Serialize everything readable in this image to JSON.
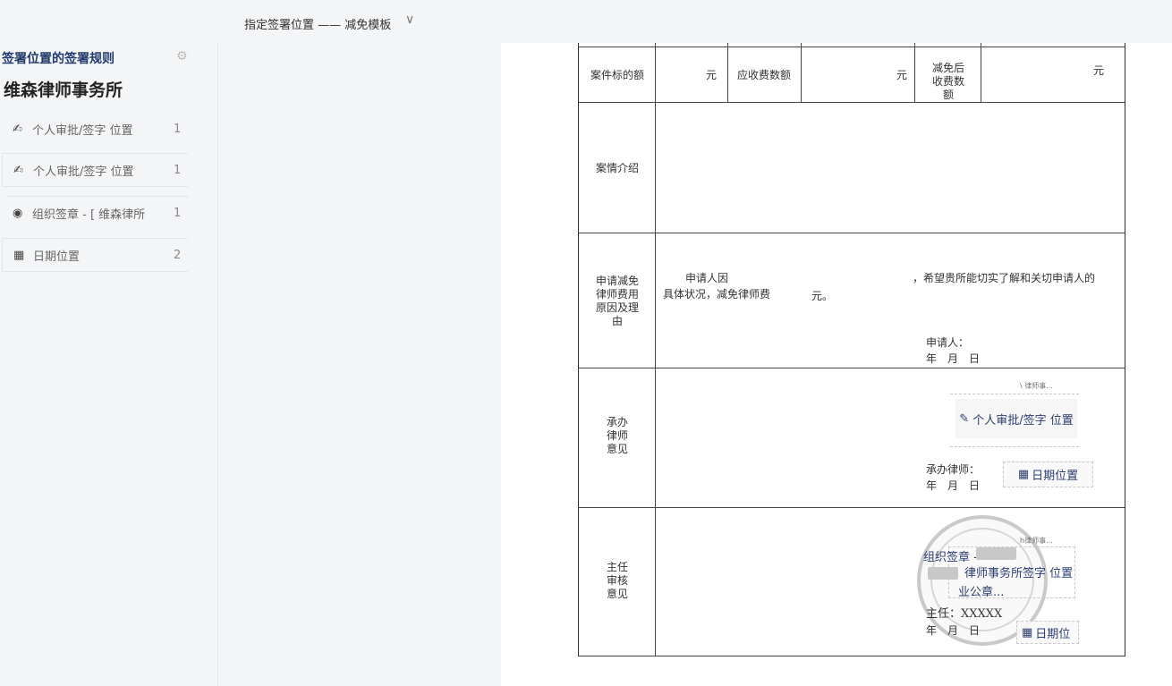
{
  "sidebar": {
    "rules_title": "签署位置的签署规则",
    "firm_name": "维森律师事务所",
    "items": [
      {
        "icon": "signature-icon",
        "label": "个人审批/签字 位置",
        "count": "1"
      },
      {
        "icon": "signature-icon",
        "label": "个人审批/签字 位置",
        "count": "1"
      },
      {
        "icon": "seal-icon",
        "label": "组织签章 - [ 维森律所",
        "count": "1"
      },
      {
        "icon": "calendar-icon",
        "label": "日期位置",
        "count": "2"
      }
    ]
  },
  "header": {
    "title": "指定签署位置 —— 减免模板",
    "dropdown_glyph": "∨"
  },
  "form": {
    "row1": {
      "label_amount": "案件标的额",
      "unit1": "元",
      "label_fee": "应收费数额",
      "unit2": "元",
      "label_reduced": "减免后收费数额",
      "unit3": "元"
    },
    "row2": {
      "label": "案情介绍"
    },
    "row3": {
      "label": "申请减免律师费用原因及理由",
      "text_start": "申请人因",
      "text_end": "，希望贵所能切实了解和关切申请人的",
      "text_line2": "具体状况，减免律师费",
      "text_unit": "元。",
      "applicant": "申请人：",
      "date": "年　月　日"
    },
    "row4": {
      "label": "承办律师意见",
      "lawyer": "承办律师：",
      "date": "年　月　日"
    },
    "row5": {
      "label": "主任审核意见",
      "director": "主任：XXXXX",
      "date": "年　月　日"
    }
  },
  "placed": {
    "sign_label": "个人审批/签字 位置",
    "date_label": "日期位置",
    "date_label_clipped": "日期位",
    "seal_label": "组织签章 -",
    "seal_line2": "业公章...",
    "sign_overlap": "律师事务所签字 位置",
    "tiny_tag": "\\ 律师事...",
    "tiny_tag2": "h律师事..."
  }
}
